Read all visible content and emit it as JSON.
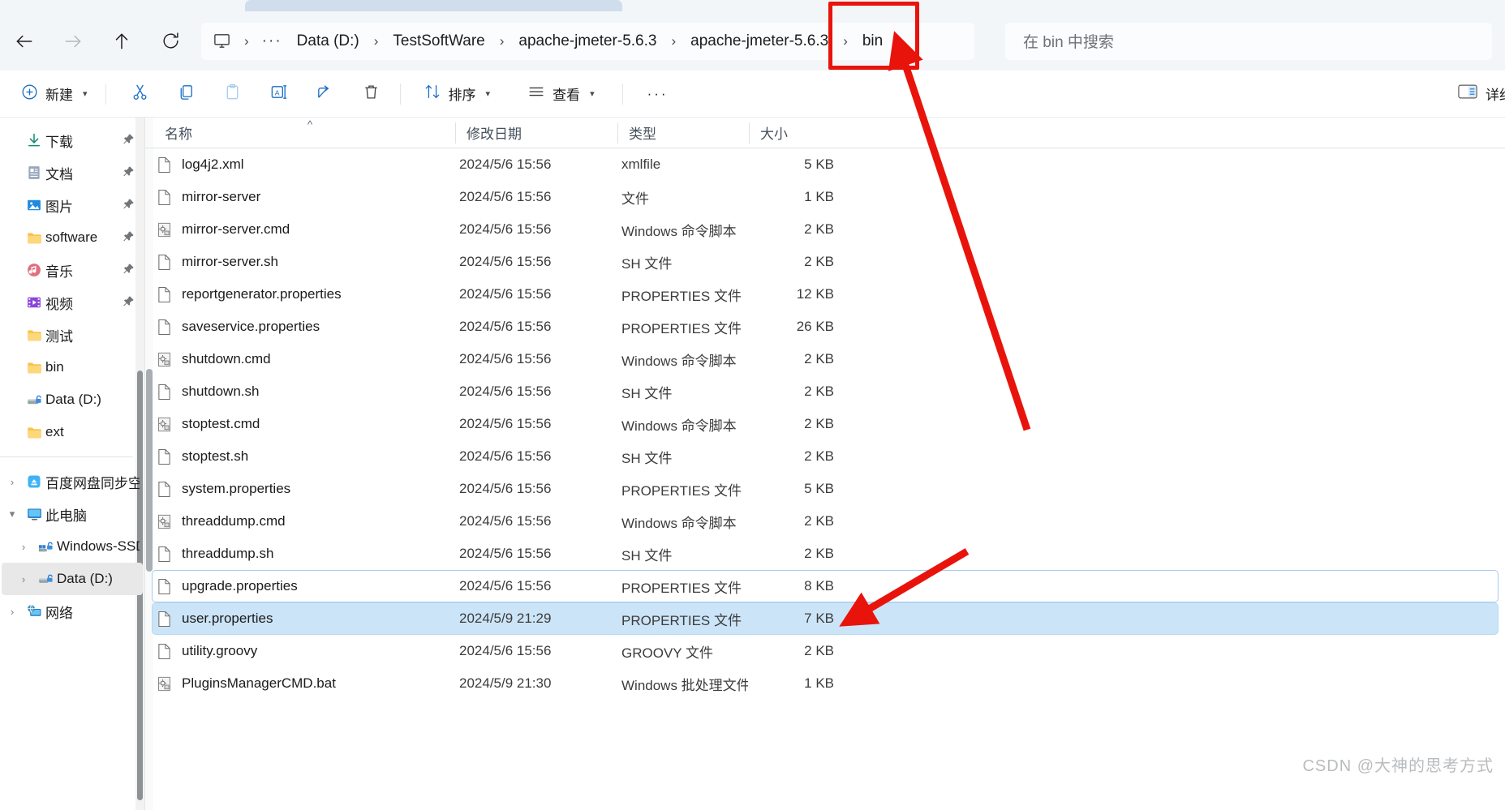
{
  "window": {
    "tab_title": ""
  },
  "nav": {
    "back": "back-arrow",
    "forward": "forward-arrow",
    "up": "up-arrow",
    "refresh": "refresh"
  },
  "breadcrumb": {
    "root_icon": "this-pc-icon",
    "overflow": "···",
    "separator": "›",
    "items": [
      {
        "label": "Data (D:)"
      },
      {
        "label": "TestSoftWare"
      },
      {
        "label": "apache-jmeter-5.6.3"
      },
      {
        "label": "apache-jmeter-5.6.3"
      },
      {
        "label": "bin"
      }
    ]
  },
  "search": {
    "placeholder": "在 bin 中搜索",
    "value": ""
  },
  "toolbar": {
    "new_label": "新建",
    "cut_label": "cut-icon",
    "copy_label": "copy-icon",
    "paste_label": "paste-icon",
    "rename_label": "rename-icon",
    "share_label": "share-icon",
    "delete_label": "delete-icon",
    "sort_label": "排序",
    "view_label": "查看",
    "more_label": "···",
    "details_label": "详细信息"
  },
  "sidebar": {
    "items": [
      {
        "label": "下载",
        "icon": "download-icon",
        "pinned": true,
        "twisty": "",
        "selected": false
      },
      {
        "label": "文档",
        "icon": "documents-icon",
        "pinned": true,
        "twisty": "",
        "selected": false
      },
      {
        "label": "图片",
        "icon": "pictures-icon",
        "pinned": true,
        "twisty": "",
        "selected": false
      },
      {
        "label": "software",
        "icon": "folder-icon",
        "pinned": true,
        "twisty": "",
        "selected": false
      },
      {
        "label": "音乐",
        "icon": "music-icon",
        "pinned": true,
        "twisty": "",
        "selected": false
      },
      {
        "label": "视频",
        "icon": "videos-icon",
        "pinned": true,
        "twisty": "",
        "selected": false
      },
      {
        "label": "测试",
        "icon": "folder-icon",
        "pinned": false,
        "twisty": "",
        "selected": false
      },
      {
        "label": "bin",
        "icon": "folder-icon",
        "pinned": false,
        "twisty": "",
        "selected": false
      },
      {
        "label": "Data (D:)",
        "icon": "drive-icon",
        "pinned": false,
        "twisty": "",
        "selected": false
      },
      {
        "label": "ext",
        "icon": "folder-icon",
        "pinned": false,
        "twisty": "",
        "selected": false
      }
    ],
    "items2": [
      {
        "label": "百度网盘同步空间",
        "icon": "baidu-netdisk-icon",
        "twisty": "›",
        "selected": false
      },
      {
        "label": "此电脑",
        "icon": "this-pc-icon",
        "twisty": "⌄",
        "selected": false
      },
      {
        "label": "Windows-SSD",
        "icon": "windows-drive-icon",
        "twisty": "›",
        "selected": false,
        "indent": true
      },
      {
        "label": "Data (D:)",
        "icon": "drive-icon",
        "twisty": "›",
        "selected": true,
        "indent": true
      },
      {
        "label": "网络",
        "icon": "network-icon",
        "twisty": "›",
        "selected": false
      }
    ]
  },
  "filelist": {
    "columns": [
      {
        "key": "name",
        "label": "名称",
        "sorted": "asc"
      },
      {
        "key": "date",
        "label": "修改日期"
      },
      {
        "key": "type",
        "label": "类型"
      },
      {
        "key": "size",
        "label": "大小"
      }
    ],
    "rows": [
      {
        "name": "log4j2.xml",
        "date": "2024/5/6 15:56",
        "type": "xmlfile",
        "size": "5 KB",
        "icon": "file-icon",
        "selected": false,
        "focused": false
      },
      {
        "name": "mirror-server",
        "date": "2024/5/6 15:56",
        "type": "文件",
        "size": "1 KB",
        "icon": "file-icon",
        "selected": false,
        "focused": false
      },
      {
        "name": "mirror-server.cmd",
        "date": "2024/5/6 15:56",
        "type": "Windows 命令脚本",
        "size": "2 KB",
        "icon": "script-icon",
        "selected": false,
        "focused": false
      },
      {
        "name": "mirror-server.sh",
        "date": "2024/5/6 15:56",
        "type": "SH 文件",
        "size": "2 KB",
        "icon": "file-icon",
        "selected": false,
        "focused": false
      },
      {
        "name": "reportgenerator.properties",
        "date": "2024/5/6 15:56",
        "type": "PROPERTIES 文件",
        "size": "12 KB",
        "icon": "file-icon",
        "selected": false,
        "focused": false
      },
      {
        "name": "saveservice.properties",
        "date": "2024/5/6 15:56",
        "type": "PROPERTIES 文件",
        "size": "26 KB",
        "icon": "file-icon",
        "selected": false,
        "focused": false
      },
      {
        "name": "shutdown.cmd",
        "date": "2024/5/6 15:56",
        "type": "Windows 命令脚本",
        "size": "2 KB",
        "icon": "script-icon",
        "selected": false,
        "focused": false
      },
      {
        "name": "shutdown.sh",
        "date": "2024/5/6 15:56",
        "type": "SH 文件",
        "size": "2 KB",
        "icon": "file-icon",
        "selected": false,
        "focused": false
      },
      {
        "name": "stoptest.cmd",
        "date": "2024/5/6 15:56",
        "type": "Windows 命令脚本",
        "size": "2 KB",
        "icon": "script-icon",
        "selected": false,
        "focused": false
      },
      {
        "name": "stoptest.sh",
        "date": "2024/5/6 15:56",
        "type": "SH 文件",
        "size": "2 KB",
        "icon": "file-icon",
        "selected": false,
        "focused": false
      },
      {
        "name": "system.properties",
        "date": "2024/5/6 15:56",
        "type": "PROPERTIES 文件",
        "size": "5 KB",
        "icon": "file-icon",
        "selected": false,
        "focused": false
      },
      {
        "name": "threaddump.cmd",
        "date": "2024/5/6 15:56",
        "type": "Windows 命令脚本",
        "size": "2 KB",
        "icon": "script-icon",
        "selected": false,
        "focused": false
      },
      {
        "name": "threaddump.sh",
        "date": "2024/5/6 15:56",
        "type": "SH 文件",
        "size": "2 KB",
        "icon": "file-icon",
        "selected": false,
        "focused": false
      },
      {
        "name": "upgrade.properties",
        "date": "2024/5/6 15:56",
        "type": "PROPERTIES 文件",
        "size": "8 KB",
        "icon": "file-icon",
        "selected": false,
        "focused": true
      },
      {
        "name": "user.properties",
        "date": "2024/5/9 21:29",
        "type": "PROPERTIES 文件",
        "size": "7 KB",
        "icon": "file-icon",
        "selected": true,
        "focused": false
      },
      {
        "name": "utility.groovy",
        "date": "2024/5/6 15:56",
        "type": "GROOVY 文件",
        "size": "2 KB",
        "icon": "file-icon",
        "selected": false,
        "focused": false
      },
      {
        "name": "PluginsManagerCMD.bat",
        "date": "2024/5/9 21:30",
        "type": "Windows 批处理文件",
        "size": "1 KB",
        "icon": "script-icon",
        "selected": false,
        "focused": false
      }
    ]
  },
  "annotations": {
    "highlight_color": "#e8140c",
    "rect_target": "bin-breadcrumb",
    "arrow1_target": "bin-breadcrumb",
    "arrow2_target": "user-properties-size-cell"
  },
  "watermark": {
    "text": "CSDN @大神的思考方式"
  }
}
